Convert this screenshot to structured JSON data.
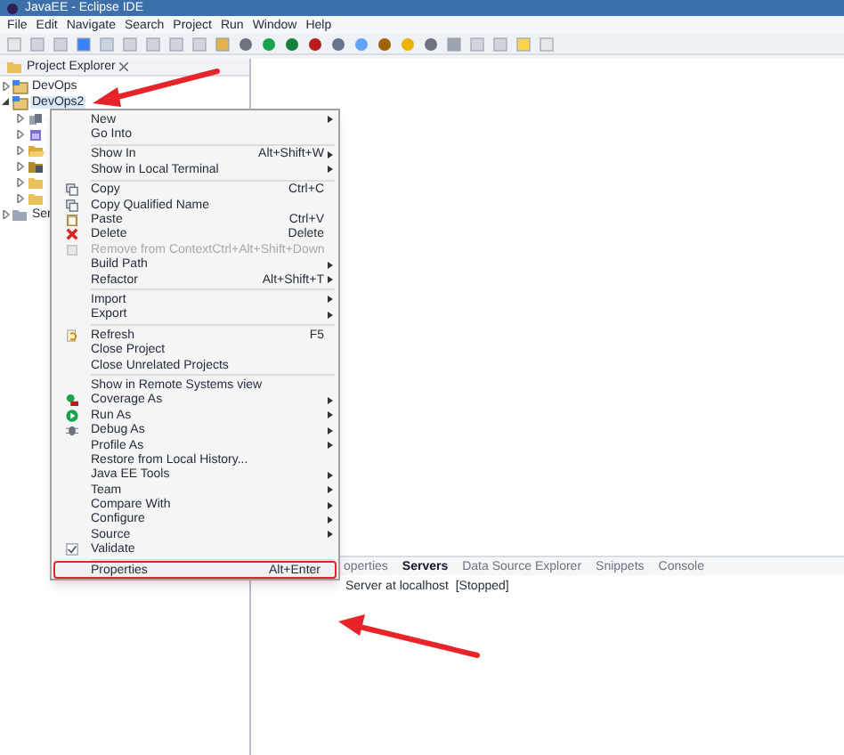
{
  "window": {
    "title": "JavaEE - Eclipse IDE"
  },
  "menu_bar": [
    "File",
    "Edit",
    "Navigate",
    "Search",
    "Project",
    "Run",
    "Window",
    "Help"
  ],
  "project_explorer": {
    "title": "Project Explorer",
    "items": [
      {
        "label": "DevOps",
        "expanded": false,
        "selected": false
      },
      {
        "label": "DevOps2",
        "expanded": true,
        "selected": true,
        "children": [
          {
            "kind": "library"
          },
          {
            "kind": "jar"
          },
          {
            "kind": "folder-open"
          },
          {
            "kind": "package"
          },
          {
            "kind": "folder"
          },
          {
            "kind": "folder"
          }
        ]
      },
      {
        "label": "Ser",
        "expanded": false,
        "selected": false
      }
    ]
  },
  "context_menu": [
    {
      "kind": "item",
      "label": "New",
      "submenu": true,
      "selected": false,
      "disabled": false
    },
    {
      "kind": "item",
      "label": "Go Into",
      "submenu": false,
      "selected": false,
      "disabled": false
    },
    {
      "kind": "separator"
    },
    {
      "kind": "item",
      "label": "Show In",
      "shortcut": "Alt+Shift+W",
      "submenu": true,
      "selected": false,
      "disabled": false
    },
    {
      "kind": "item",
      "label": "Show in Local Terminal",
      "submenu": true,
      "selected": false,
      "disabled": false
    },
    {
      "kind": "separator"
    },
    {
      "kind": "item",
      "label": "Copy",
      "shortcut": "Ctrl+C",
      "submenu": false,
      "selected": false,
      "disabled": false
    },
    {
      "kind": "item",
      "label": "Copy Qualified Name",
      "submenu": false,
      "selected": false,
      "disabled": false
    },
    {
      "kind": "item",
      "label": "Paste",
      "shortcut": "Ctrl+V",
      "submenu": false,
      "selected": false,
      "disabled": false
    },
    {
      "kind": "item",
      "label": "Delete",
      "shortcut": "Delete",
      "submenu": false,
      "selected": false,
      "disabled": false
    },
    {
      "kind": "item",
      "label": "Remove from Context",
      "shortcut": "Ctrl+Alt+Shift+Down",
      "submenu": false,
      "selected": false,
      "disabled": true
    },
    {
      "kind": "item",
      "label": "Build Path",
      "submenu": true,
      "selected": false,
      "disabled": false
    },
    {
      "kind": "item",
      "label": "Refactor",
      "shortcut": "Alt+Shift+T",
      "submenu": true,
      "selected": false,
      "disabled": false
    },
    {
      "kind": "separator"
    },
    {
      "kind": "item",
      "label": "Import",
      "submenu": true,
      "selected": false,
      "disabled": false
    },
    {
      "kind": "item",
      "label": "Export",
      "submenu": true,
      "selected": false,
      "disabled": false
    },
    {
      "kind": "separator"
    },
    {
      "kind": "item",
      "label": "Refresh",
      "shortcut": "F5",
      "submenu": false,
      "selected": false,
      "disabled": false
    },
    {
      "kind": "item",
      "label": "Close Project",
      "submenu": false,
      "selected": false,
      "disabled": false
    },
    {
      "kind": "item",
      "label": "Close Unrelated Projects",
      "submenu": false,
      "selected": false,
      "disabled": false
    },
    {
      "kind": "separator"
    },
    {
      "kind": "item",
      "label": "Show in Remote Systems view",
      "submenu": false,
      "selected": false,
      "disabled": false
    },
    {
      "kind": "item",
      "label": "Coverage As",
      "submenu": true,
      "selected": false,
      "disabled": false
    },
    {
      "kind": "item",
      "label": "Run As",
      "submenu": true,
      "selected": false,
      "disabled": false
    },
    {
      "kind": "item",
      "label": "Debug As",
      "submenu": true,
      "selected": false,
      "disabled": false
    },
    {
      "kind": "item",
      "label": "Profile As",
      "submenu": true,
      "selected": false,
      "disabled": false
    },
    {
      "kind": "item",
      "label": "Restore from Local History...",
      "submenu": false,
      "selected": false,
      "disabled": false
    },
    {
      "kind": "item",
      "label": "Java EE Tools",
      "submenu": true,
      "selected": false,
      "disabled": false
    },
    {
      "kind": "item",
      "label": "Team",
      "submenu": true,
      "selected": false,
      "disabled": false
    },
    {
      "kind": "item",
      "label": "Compare With",
      "submenu": true,
      "selected": false,
      "disabled": false
    },
    {
      "kind": "item",
      "label": "Configure",
      "submenu": true,
      "selected": false,
      "disabled": false
    },
    {
      "kind": "item",
      "label": "Source",
      "submenu": true,
      "selected": false,
      "disabled": false
    },
    {
      "kind": "item",
      "label": "Validate",
      "submenu": false,
      "selected": false,
      "disabled": false
    },
    {
      "kind": "separator"
    },
    {
      "kind": "item",
      "label": "Properties",
      "shortcut": "Alt+Enter",
      "submenu": false,
      "selected": true,
      "disabled": false
    }
  ],
  "bottom_panel": {
    "tabs": [
      {
        "label": "operties",
        "selected": false
      },
      {
        "label": "Servers",
        "selected": true
      },
      {
        "label": "Data Source Explorer",
        "selected": false
      },
      {
        "label": "Snippets",
        "selected": false
      },
      {
        "label": "Console",
        "selected": false
      }
    ],
    "rows": [
      "Server at localhost  [Stopped]"
    ]
  }
}
